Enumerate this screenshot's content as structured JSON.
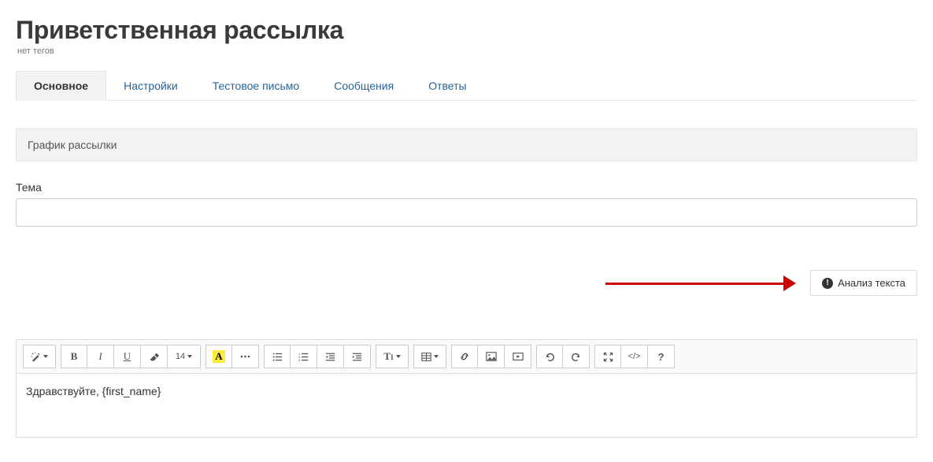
{
  "header": {
    "title": "Приветственная рассылка",
    "no_tags": "нет тегов"
  },
  "tabs": [
    {
      "label": "Основное",
      "active": true
    },
    {
      "label": "Настройки",
      "active": false
    },
    {
      "label": "Тестовое письмо",
      "active": false
    },
    {
      "label": "Сообщения",
      "active": false
    },
    {
      "label": "Ответы",
      "active": false
    }
  ],
  "schedule": {
    "title": "График рассылки"
  },
  "subject": {
    "label": "Тема",
    "value": ""
  },
  "analysis": {
    "button_label": "Анализ текста"
  },
  "toolbar": {
    "font_size_label": "14",
    "highlight_letter": "A"
  },
  "editor": {
    "content": "Здравствуйте, {first_name}"
  }
}
